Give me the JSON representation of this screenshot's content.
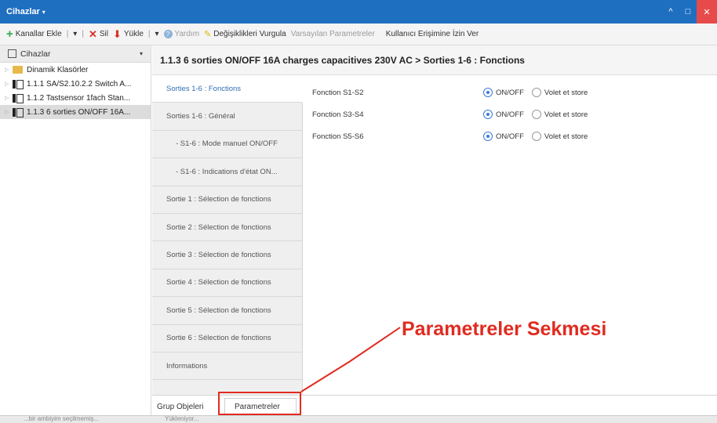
{
  "titlebar": {
    "title": "Cihazlar",
    "caret": "▾",
    "controls": [
      "^",
      "□",
      "✕"
    ]
  },
  "toolbar": {
    "add_label": "Kanallar Ekle",
    "delete_label": "Sil",
    "load_label": "Yükle",
    "help_label": "Yardım",
    "highlight_label": "Değişiklikleri Vurgula",
    "defaults_label": "Varsayılan Parametreler",
    "access_label": "Kullanıcı Erişimine İzin Ver"
  },
  "sidebar": {
    "header": "Cihazlar",
    "items": [
      {
        "label": "Dinamik Klasörler",
        "type": "folder"
      },
      {
        "label": "1.1.1 SA/S2.10.2.2 Switch A...",
        "type": "device"
      },
      {
        "label": "1.1.2 Tastsensor 1fach Stan...",
        "type": "device"
      },
      {
        "label": "1.1.3 6 sorties ON/OFF 16A...",
        "type": "device",
        "selected": true
      }
    ]
  },
  "breadcrumb": "1.1.3 6 sorties ON/OFF 16A charges capacitives 230V AC > Sorties 1-6 : Fonctions",
  "param_tabs": [
    {
      "label": "Sorties 1-6 : Fonctions",
      "active": true,
      "level": 1
    },
    {
      "label": "Sorties 1-6 : Général",
      "level": 1
    },
    {
      "label": "- S1-6 : Mode manuel ON/OFF",
      "level": 2
    },
    {
      "label": "- S1-6 : Indications d'état ON...",
      "level": 2
    },
    {
      "label": "Sortie 1 : Sélection de fonctions",
      "level": 1
    },
    {
      "label": "Sortie 2 : Sélection de fonctions",
      "level": 1
    },
    {
      "label": "Sortie 3 : Sélection de fonctions",
      "level": 1
    },
    {
      "label": "Sortie 4 : Sélection de fonctions",
      "level": 1
    },
    {
      "label": "Sortie 5 : Sélection de fonctions",
      "level": 1
    },
    {
      "label": "Sortie 6 : Sélection de fonctions",
      "level": 1
    },
    {
      "label": "Informations",
      "level": 1
    }
  ],
  "parameters": [
    {
      "label": "Fonction S1-S2",
      "opt1": "ON/OFF",
      "opt2": "Volet et store",
      "selected": "ON/OFF"
    },
    {
      "label": "Fonction S3-S4",
      "opt1": "ON/OFF",
      "opt2": "Volet et store",
      "selected": "ON/OFF"
    },
    {
      "label": "Fonction S5-S6",
      "opt1": "ON/OFF",
      "opt2": "Volet et store",
      "selected": "ON/OFF"
    }
  ],
  "bottom_tabs": {
    "group": "Grup Objeleri",
    "params": "Parametreler"
  },
  "status": {
    "left": "...bir ambiyim seçilmemiş...",
    "right": "Yükleniyor..."
  },
  "callout": {
    "text": "Parametreler Sekmesi",
    "color": "#e02b20"
  },
  "colors": {
    "titlebar": "#1e6fc0",
    "active_tab_text": "#2f6fb3",
    "radio_selected": "#3a7bd5"
  }
}
